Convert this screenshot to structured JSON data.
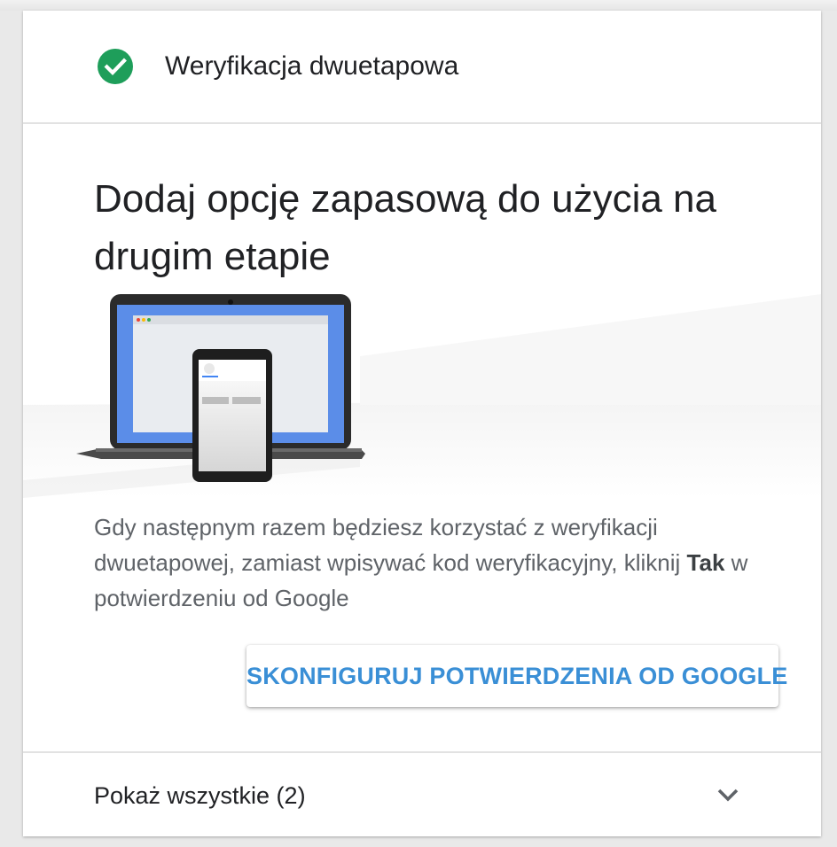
{
  "header": {
    "title": "Weryfikacja dwuetapowa",
    "icon": "check-circle-icon",
    "icon_color": "#1e9e5a"
  },
  "main": {
    "title": "Dodaj opcję zapasową do użycia na drugim etapie",
    "description_before": "Gdy następnym razem będziesz korzystać z weryfikacji dwuetapowej, zamiast wpisywać kod weryfikacyjny, kliknij ",
    "description_bold": "Tak",
    "description_after": " w potwierdzeniu od Google",
    "button_label": "SKONFIGURUJ POTWIERDZENIA OD GOOGLE",
    "button_color": "#3a8fd6"
  },
  "footer": {
    "show_all_label": "Pokaż wszystkie (2)",
    "icon": "chevron-down-icon"
  },
  "illustration": {
    "description_icon": "laptop-and-phone-icon",
    "screen_color": "#5b8de8"
  }
}
